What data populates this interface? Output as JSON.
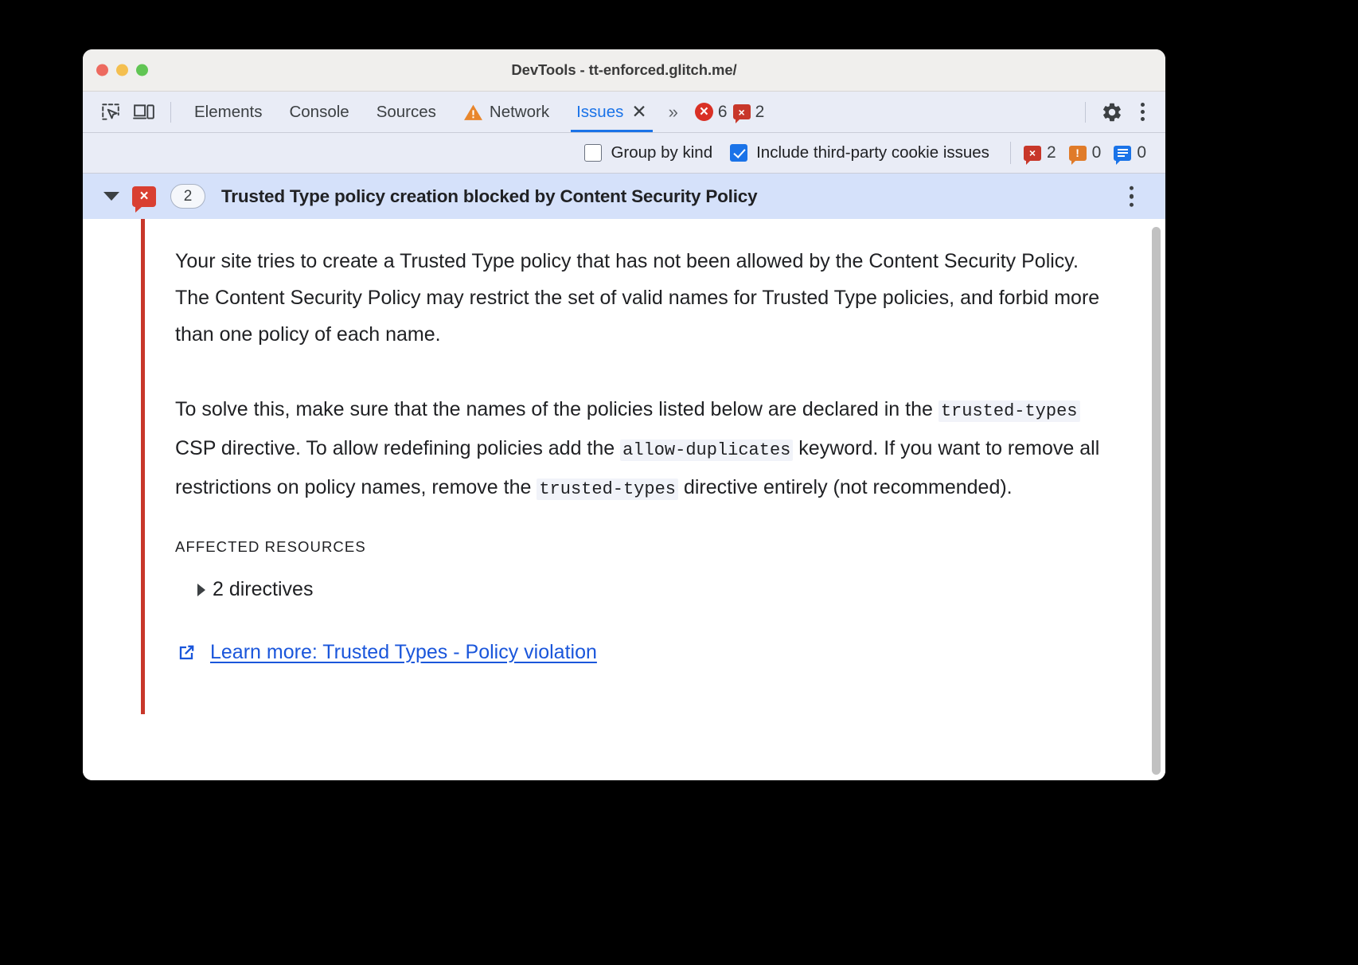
{
  "window": {
    "title": "DevTools - tt-enforced.glitch.me/",
    "traffic_lights": [
      "close",
      "minimize",
      "maximize"
    ]
  },
  "tabbar": {
    "inspect_icon": "inspect-element-icon",
    "device_icon": "device-toolbar-icon",
    "tabs": [
      {
        "label": "Elements",
        "active": false,
        "warning": false
      },
      {
        "label": "Console",
        "active": false,
        "warning": false
      },
      {
        "label": "Sources",
        "active": false,
        "warning": false
      },
      {
        "label": "Network",
        "active": false,
        "warning": true
      },
      {
        "label": "Issues",
        "active": true,
        "warning": false,
        "closable": true
      }
    ],
    "close_glyph": "✕",
    "more_tabs_glyph": "»",
    "counters": [
      {
        "type": "error",
        "value": "6"
      },
      {
        "type": "issue",
        "value": "2"
      }
    ],
    "settings_icon": "gear-icon",
    "menu_icon": "kebab-menu-icon"
  },
  "filterbar": {
    "group_by_kind": {
      "label": "Group by kind",
      "checked": false
    },
    "include_third_party": {
      "label": "Include third-party cookie issues",
      "checked": true
    },
    "counts": [
      {
        "type": "error",
        "value": "2",
        "glyph": "×"
      },
      {
        "type": "warning",
        "value": "0",
        "glyph": "!"
      },
      {
        "type": "info",
        "value": "0",
        "glyph": "info"
      }
    ]
  },
  "issue": {
    "expanded": true,
    "severity_glyph": "×",
    "count": "2",
    "title": "Trusted Type policy creation blocked by Content Security Policy",
    "kebab": "issue-menu-icon",
    "paragraph_1": "Your site tries to create a Trusted Type policy that has not been allowed by the Content Security Policy. The Content Security Policy may restrict the set of valid names for Trusted Type policies, and forbid more than one policy of each name.",
    "paragraph_2": {
      "t1": "To solve this, make sure that the names of the policies listed below are declared in the ",
      "c1": "trusted-types",
      "t2": " CSP directive. To allow redefining policies add the ",
      "c2": "allow-duplicates",
      "t3": " keyword. If you want to remove all restrictions on policy names, remove the ",
      "c3": "trusted-types",
      "t4": " directive entirely (not recommended)."
    },
    "affected_resources_heading": "AFFECTED RESOURCES",
    "resources": [
      {
        "label": "2 directives",
        "expanded": false
      }
    ],
    "learn_more": {
      "label": "Learn more: Trusted Types - Policy violation",
      "icon": "external-link-icon"
    },
    "accent_color": "#c8372a",
    "header_bg": "#d5e1fa"
  },
  "colors": {
    "accent_blue": "#1a73e8",
    "link_blue": "#1a56db",
    "error_red": "#d93025",
    "warning_orange": "#e07b29",
    "toolbar_bg": "#e9ecf6"
  }
}
